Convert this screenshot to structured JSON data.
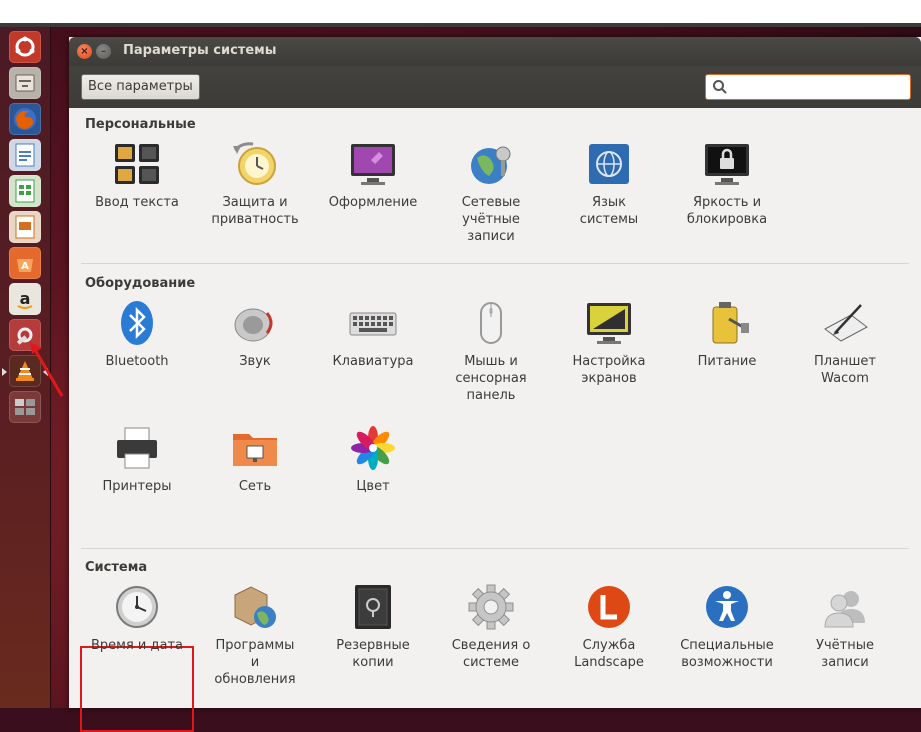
{
  "window": {
    "title": "Параметры системы",
    "all_settings_label": "Все параметры",
    "search_placeholder": ""
  },
  "colors": {
    "accent_orange": "#d56d2c",
    "highlight_red": "#e0181b"
  },
  "sections": {
    "personal": {
      "title": "Персональные",
      "items": [
        {
          "label": "Ввод текста",
          "icon": "keyboard-layout-icon"
        },
        {
          "label": "Защита и\nприватность",
          "icon": "privacy-clock-icon"
        },
        {
          "label": "Оформление",
          "icon": "appearance-monitor-icon"
        },
        {
          "label": "Сетевые\nучётные\nзаписи",
          "icon": "online-accounts-icon"
        },
        {
          "label": "Язык\nсистемы",
          "icon": "language-flag-icon"
        },
        {
          "label": "Яркость и\nблокировка",
          "icon": "brightness-lock-icon"
        }
      ]
    },
    "hardware": {
      "title": "Оборудование",
      "items": [
        {
          "label": "Bluetooth",
          "icon": "bluetooth-icon"
        },
        {
          "label": "Звук",
          "icon": "speaker-icon"
        },
        {
          "label": "Клавиатура",
          "icon": "keyboard-icon"
        },
        {
          "label": "Мышь и\nсенсорная\nпанель",
          "icon": "mouse-icon"
        },
        {
          "label": "Настройка\nэкранов",
          "icon": "display-icon"
        },
        {
          "label": "Питание",
          "icon": "battery-icon"
        },
        {
          "label": "Планшет\nWacom",
          "icon": "tablet-icon"
        },
        {
          "label": "Принтеры",
          "icon": "printer-icon"
        },
        {
          "label": "Сеть",
          "icon": "network-folder-icon"
        },
        {
          "label": "Цвет",
          "icon": "color-flower-icon"
        }
      ]
    },
    "system": {
      "title": "Система",
      "items": [
        {
          "label": "Время и дата",
          "icon": "clock-icon"
        },
        {
          "label": "Программы\nи\nобновления",
          "icon": "software-updates-icon"
        },
        {
          "label": "Резервные\nкопии",
          "icon": "backup-safe-icon"
        },
        {
          "label": "Сведения о\nсистеме",
          "icon": "gear-icon"
        },
        {
          "label": "Служба\nLandscape",
          "icon": "landscape-icon"
        },
        {
          "label": "Специальные\nвозможности",
          "icon": "accessibility-icon"
        },
        {
          "label": "Учётные\nзаписи",
          "icon": "user-accounts-icon"
        }
      ]
    }
  },
  "launcher": [
    {
      "icon": "ubuntu-dash-icon"
    },
    {
      "icon": "files-icon"
    },
    {
      "icon": "firefox-icon"
    },
    {
      "icon": "writer-icon"
    },
    {
      "icon": "calc-icon"
    },
    {
      "icon": "impress-icon"
    },
    {
      "icon": "software-center-icon"
    },
    {
      "icon": "amazon-icon"
    },
    {
      "icon": "system-settings-icon"
    },
    {
      "icon": "vlc-icon"
    },
    {
      "icon": "workspace-switcher-icon"
    }
  ]
}
